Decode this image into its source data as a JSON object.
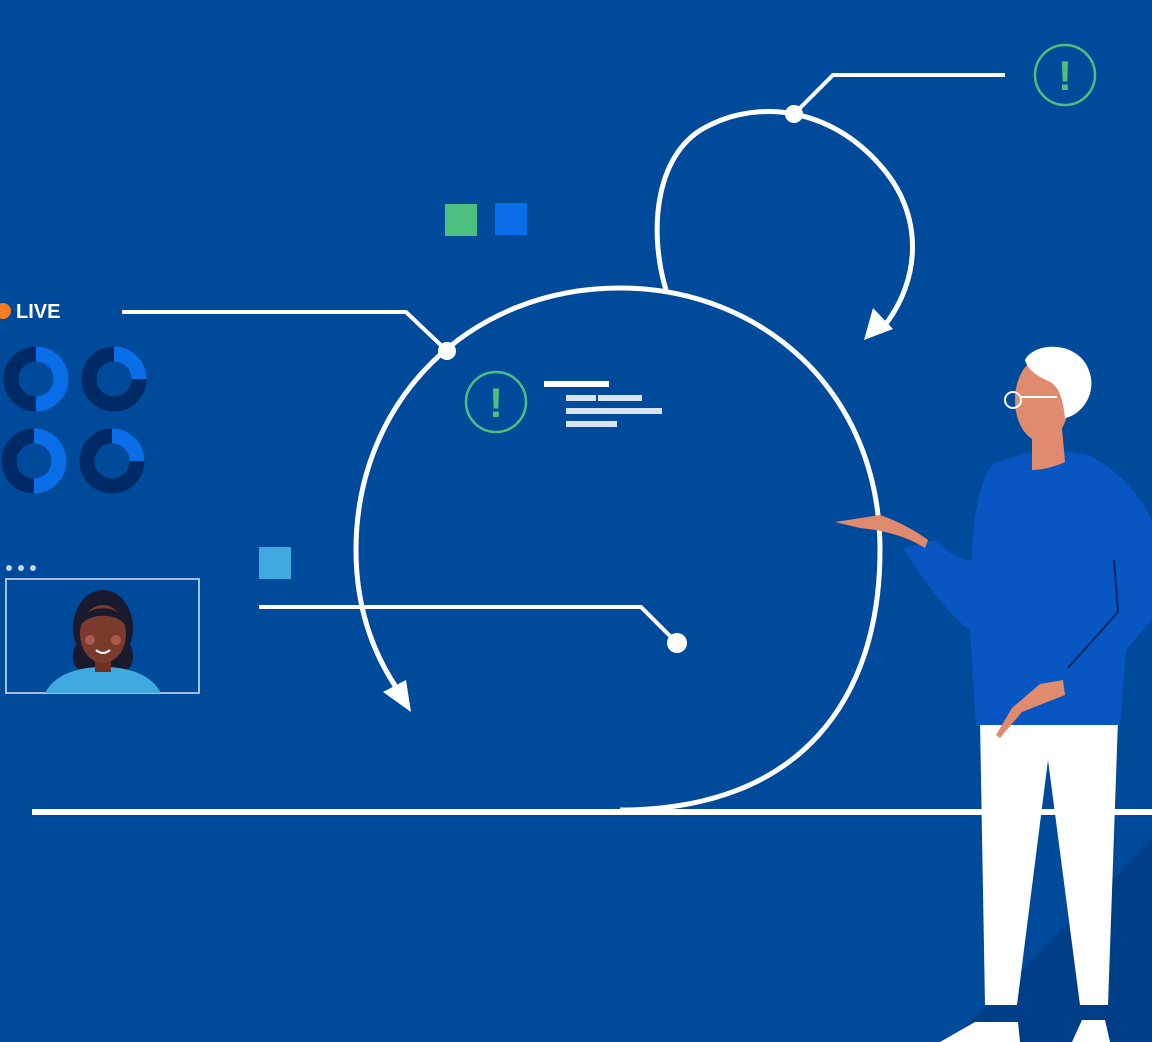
{
  "live_indicator": {
    "label": "LIVE"
  },
  "alerts": [
    {
      "glyph": "!"
    },
    {
      "glyph": "!"
    }
  ],
  "colors": {
    "background": "#004a9c",
    "line": "#ffffff",
    "alert_green": "#4dbf7f",
    "square_green": "#4dbf7f",
    "square_blue": "#0a6ee8",
    "square_light_blue": "#3fa9e0",
    "donut_dark": "#002a66",
    "donut_bright": "#0a6ee8",
    "live_dot": "#f57c21",
    "sweater": "#0756c2",
    "skin": "#e08a6e"
  },
  "donut_charts": [
    {
      "filled_fraction": 0.5
    },
    {
      "filled_fraction": 0.25
    },
    {
      "filled_fraction": 0.5
    },
    {
      "filled_fraction": 0.25
    }
  ],
  "icons": [
    "close-icon",
    "more-options-icon"
  ]
}
